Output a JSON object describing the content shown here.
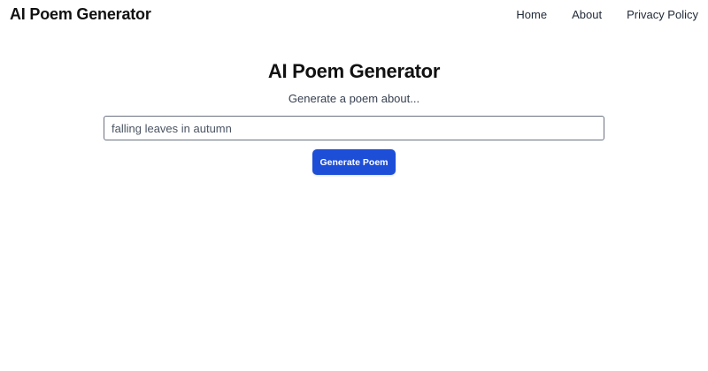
{
  "header": {
    "brand": "AI Poem Generator",
    "nav": [
      {
        "label": "Home"
      },
      {
        "label": "About"
      },
      {
        "label": "Privacy Policy"
      }
    ]
  },
  "main": {
    "title": "AI Poem Generator",
    "subtitle": "Generate a poem about...",
    "prompt": {
      "value": "falling leaves in autumn",
      "placeholder": ""
    },
    "generate_label": "Generate Poem"
  },
  "colors": {
    "accent": "#1d4ed8",
    "text": "#111111",
    "muted": "#374151"
  }
}
